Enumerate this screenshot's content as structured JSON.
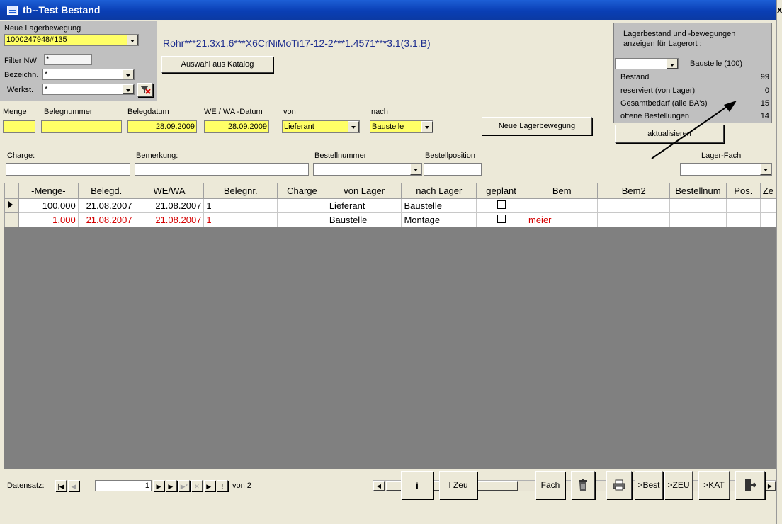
{
  "window": {
    "title": "tb--Test Bestand",
    "close_glyph": "x"
  },
  "top": {
    "neue_lagerbewegung_label": "Neue Lagerbewegung",
    "neue_lagerbewegung_value": "1000247948#135",
    "product_desc": "Rohr***21.3x1.6***X6CrNiMoTi17-12-2***1.4571***3.1(3.1.B)",
    "filter_nw_label": "Filter NW",
    "filter_nw_value": "*",
    "bezeichn_label": "Bezeichn.",
    "bezeichn_value": "*",
    "werkst_label": "Werkst.",
    "werkst_value": "*",
    "auswahl_button": "Auswahl aus Katalog"
  },
  "info_panel": {
    "heading1": "Lagerbestand  und -bewegungen",
    "heading2": "anzeigen für Lagerort :",
    "lagerort_value": "",
    "lagerort_label": "Baustelle (100)",
    "rows": [
      {
        "label": "Bestand",
        "value": "99"
      },
      {
        "label": "reserviert (von Lager)",
        "value": "0"
      },
      {
        "label": "Gesamtbedarf (alle BA's)",
        "value": "15"
      },
      {
        "label": "offene Bestellungen",
        "value": "14"
      }
    ],
    "refresh_button": "aktualisieren"
  },
  "entry_row": {
    "menge_label": "Menge",
    "menge_value": "",
    "belegnummer_label": "Belegnummer",
    "belegnummer_value": "",
    "belegdatum_label": "Belegdatum",
    "belegdatum_value": "28.09.2009",
    "wewa_label": "WE / WA -Datum",
    "wewa_value": "28.09.2009",
    "von_label": "von",
    "von_value": "Lieferant",
    "nach_label": "nach",
    "nach_value": "Baustelle",
    "neue_button": "Neue Lagerbewegung"
  },
  "second_row": {
    "charge_label": "Charge:",
    "charge_value": "",
    "bemerkung_label": "Bemerkung:",
    "bemerkung_value": "",
    "bestellnummer_label": "Bestellnummer",
    "bestellnummer_value": "",
    "bestellposition_label": "Bestellposition",
    "bestellposition_value": "",
    "lagerfach_label": "Lager-Fach",
    "lagerfach_value": ""
  },
  "grid": {
    "columns": [
      "-Menge-",
      "Belegd.",
      "WE/WA",
      "Belegnr.",
      "Charge",
      "von Lager",
      "nach Lager",
      "geplant",
      "Bem",
      "Bem2",
      "Bestellnum",
      "Pos.",
      "Ze"
    ],
    "rows": [
      {
        "menge": "100,000",
        "belegd": "21.08.2007",
        "wewa": "21.08.2007",
        "belegnr": "1",
        "charge": "",
        "von": "Lieferant",
        "nach": "Baustelle",
        "geplant": false,
        "bem": "",
        "bem2": "",
        "bestellnum": "",
        "pos": "",
        "ze": "",
        "highlight": false
      },
      {
        "menge": "1,000",
        "belegd": "21.08.2007",
        "wewa": "21.08.2007",
        "belegnr": "1",
        "charge": "",
        "von": "Baustelle",
        "nach": "Montage",
        "geplant": false,
        "bem": "meier",
        "bem2": "",
        "bestellnum": "",
        "pos": "",
        "ze": "",
        "highlight": true
      }
    ]
  },
  "navigation": {
    "label": "Datensatz:",
    "current": "1",
    "of_label": "von 2"
  },
  "bottom_buttons": {
    "info": "i",
    "izeu": "I Zeu",
    "fach": "Fach",
    "best": ">Best",
    "zeu": ">ZEU",
    "kat": ">KAT"
  },
  "colors": {
    "title_bar": "#0a3fb5",
    "highlight_red": "#d40000",
    "yellow_field": "#ffff66",
    "dark_area": "#808080"
  }
}
